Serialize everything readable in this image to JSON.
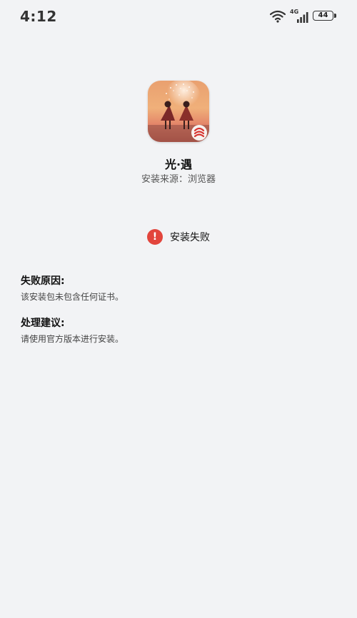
{
  "status_bar": {
    "time": "4:12",
    "network": "4G",
    "battery": "44"
  },
  "app": {
    "name": "光·遇",
    "install_source": "安装来源：浏览器",
    "icon_name": "sky-game-app-icon"
  },
  "result": {
    "icon": "!",
    "text": "安装失败",
    "color": "#e2453c"
  },
  "failure_reason": {
    "title": "失败原因:",
    "body": "该安装包未包含任何证书。"
  },
  "suggestion": {
    "title": "处理建议:",
    "body": "请使用官方版本进行安装。"
  },
  "colors": {
    "background": "#f2f3f5",
    "error": "#e2453c"
  }
}
